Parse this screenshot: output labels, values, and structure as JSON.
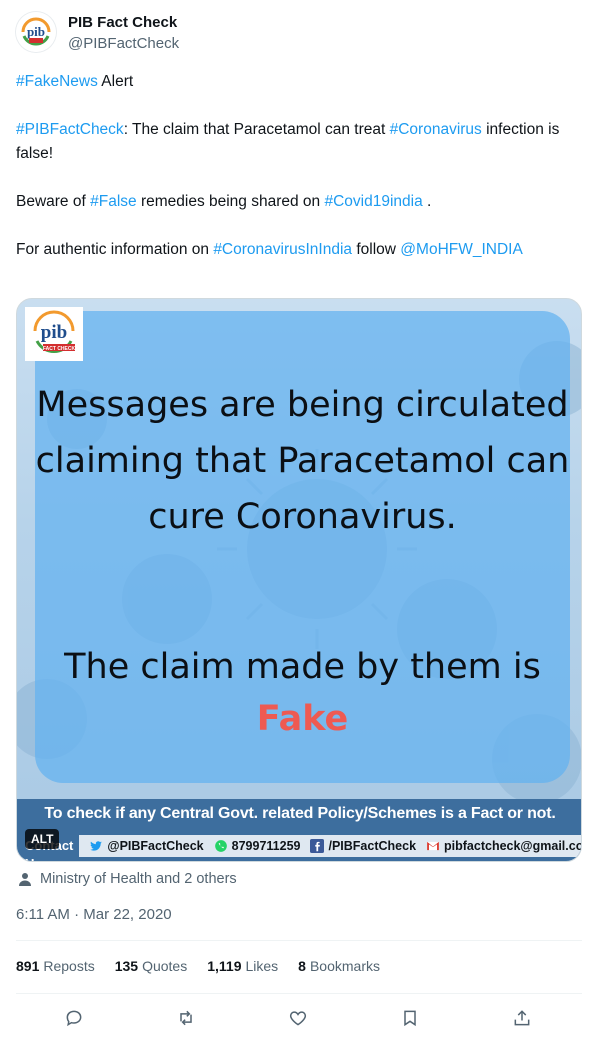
{
  "header": {
    "display_name": "PIB Fact Check",
    "handle": "@PIBFactCheck",
    "avatar_text": "pib",
    "avatar_sub": "FACT CHECK"
  },
  "tweet": {
    "line1_tag": "#FakeNews",
    "line1_rest": " Alert",
    "p2_tag1": "#PIBFactCheck",
    "p2_text1": ": The claim that Paracetamol can treat ",
    "p2_tag2": "#Coronavirus",
    "p2_text2": " infection is false!",
    "p3_text1": "Beware of ",
    "p3_tag1": "#False",
    "p3_text2": " remedies being shared on ",
    "p3_tag2": "#Covid19india",
    "p3_text3": " .",
    "p4_text1": "For authentic information on ",
    "p4_tag1": "#CoronavirusInIndia",
    "p4_text2": " follow ",
    "p4_mention": "@MoHFW_INDIA"
  },
  "media": {
    "logo_text": "pib",
    "logo_sub": "FACT CHECK",
    "message": "Messages are being circulated claiming that Paracetamol can cure Coronavirus.",
    "claim_text": "The claim made by them is ",
    "claim_fake": "Fake",
    "banner_title": "To check if any Central Govt. related Policy/Schemes is a Fact or not.",
    "contact_label": "Contact Us",
    "twitter": "@PIBFactCheck",
    "whatsapp": "8799711259",
    "facebook": "/PIBFactCheck",
    "email": "pibfactcheck@gmail.com",
    "alt_badge": "ALT"
  },
  "tagged": "Ministry of Health and 2 others",
  "timestamp": "6:11 AM · Mar 22, 2020",
  "stats": {
    "reposts_count": "891",
    "reposts_label": "Reposts",
    "quotes_count": "135",
    "quotes_label": "Quotes",
    "likes_count": "1,119",
    "likes_label": "Likes",
    "bookmarks_count": "8",
    "bookmarks_label": "Bookmarks"
  },
  "icons": [
    "reply-icon",
    "repost-icon",
    "like-icon",
    "bookmark-icon",
    "share-icon"
  ],
  "colors": {
    "link": "#1d9bf0",
    "secondary": "#536471",
    "fake": "#ee5a52",
    "banner": "#3d6e9e"
  }
}
